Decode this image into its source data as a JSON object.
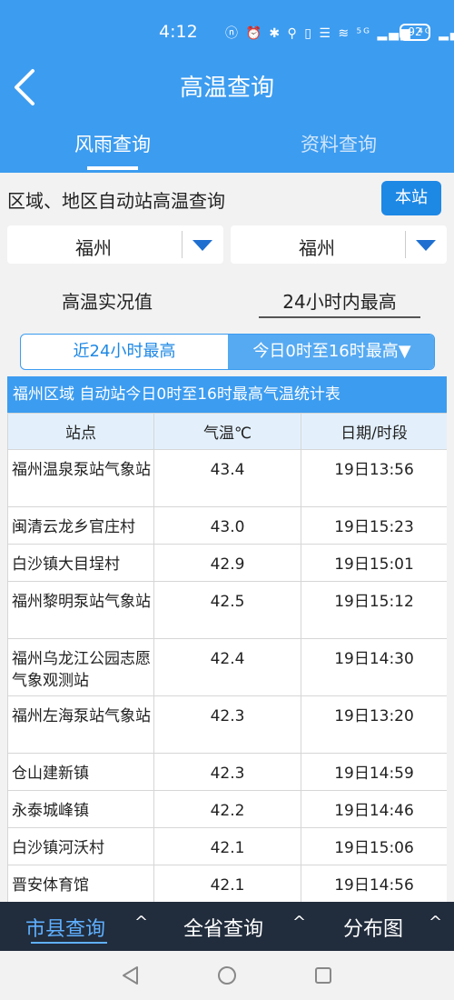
{
  "status": {
    "time": "4:12",
    "icons": "ⓝ ⏰ ✱ ⚲ ▯ ☰ ≋ ⁵ᴳ ▂▄▆ ⁴ᴳ ▂▄▆",
    "battery": "92"
  },
  "header": {
    "title": "高温查询",
    "tabs": [
      "风雨查询",
      "资料查询"
    ]
  },
  "query": {
    "label": "区域、地区自动站高温查询",
    "station_button": "本站"
  },
  "selects": {
    "left": "福州",
    "right": "福州"
  },
  "mode": {
    "left": "高温实况值",
    "right": "24小时内最高"
  },
  "segment": {
    "left": "近24小时最高",
    "right": "今日0时至16时最高▼"
  },
  "table": {
    "title": "福州区域 自动站今日0时至16时最高气温统计表",
    "headers": [
      "站点",
      "气温℃",
      "日期/时段"
    ],
    "rows": [
      [
        "福州温泉泵站气象站",
        "43.4",
        "19日13:56"
      ],
      [
        "闽清云龙乡官庄村",
        "43.0",
        "19日15:23"
      ],
      [
        "白沙镇大目埕村",
        "42.9",
        "19日15:01"
      ],
      [
        "福州黎明泵站气象站",
        "42.5",
        "19日15:12"
      ],
      [
        "福州乌龙江公园志愿气象观测站",
        "42.4",
        "19日14:30"
      ],
      [
        "福州左海泵站气象站",
        "42.3",
        "19日13:20"
      ],
      [
        "仓山建新镇",
        "42.3",
        "19日14:59"
      ],
      [
        "永泰城峰镇",
        "42.2",
        "19日14:46"
      ],
      [
        "白沙镇河沃村",
        "42.1",
        "19日15:06"
      ],
      [
        "晋安体育馆",
        "42.1",
        "19日14:56"
      ]
    ]
  },
  "bottom_nav": {
    "county": "市县查询",
    "province": "全省查询",
    "distribution": "分布图",
    "caret": "^"
  },
  "colors": {
    "primary": "#3c9cf0",
    "button": "#1e88e5",
    "nav_bg": "#212c3c",
    "nav_active": "#5fb0ff"
  }
}
